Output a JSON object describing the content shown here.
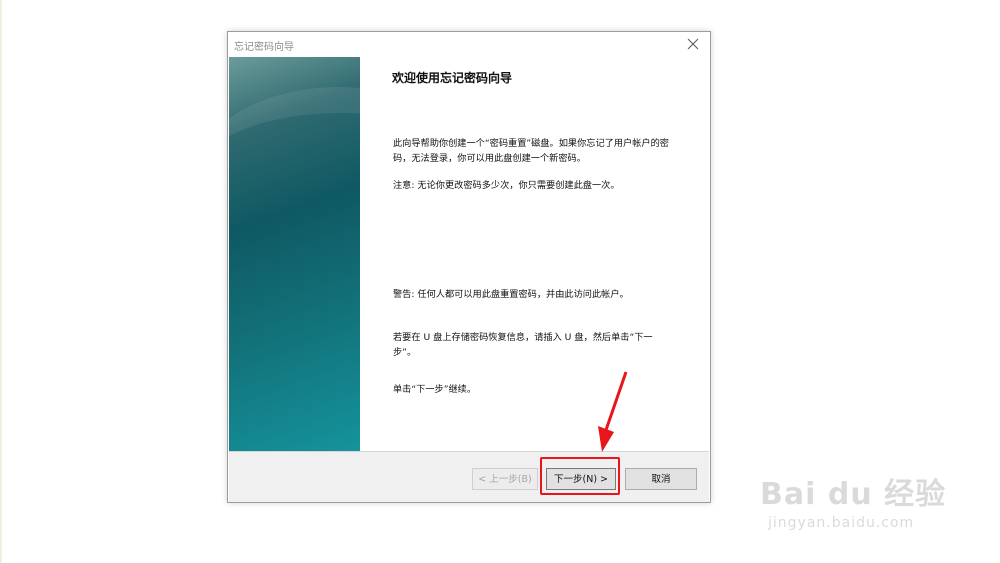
{
  "window": {
    "title": "忘记密码向导",
    "close_icon": "close-icon"
  },
  "content": {
    "heading": "欢迎使用忘记密码向导",
    "para1": "此向导帮助你创建一个“密码重置”磁盘。如果你忘记了用户帐户的密码，无法登录，你可以用此盘创建一个新密码。",
    "para2": "注意: 无论你更改密码多少次，你只需要创建此盘一次。",
    "para3": "警告: 任何人都可以用此盘重置密码，并由此访问此帐户。",
    "para4": "若要在 U 盘上存储密码恢复信息，请插入 U 盘，然后单击“下一步”。",
    "para5": "单击“下一步”继续。"
  },
  "buttons": {
    "back": "< 上一步(B)",
    "next": "下一步(N) >",
    "cancel": "取消"
  },
  "annotation": {
    "highlight_color": "#e8161b",
    "arrow_icon": "red-arrow-icon"
  },
  "watermark": {
    "main": "Bai du 经验",
    "sub": "jingyan.baidu.com"
  }
}
